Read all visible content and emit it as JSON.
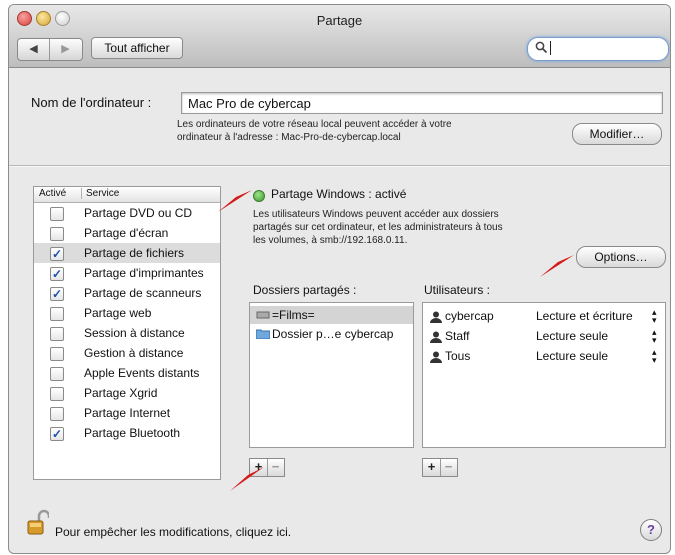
{
  "window": {
    "title": "Partage"
  },
  "toolbar": {
    "back_label": "◀",
    "forward_label": "▶",
    "show_all_label": "Tout afficher",
    "search_value": "",
    "search_icon": "magnifier-icon"
  },
  "computer": {
    "name_label": "Nom de l'ordinateur :",
    "name_value": "Mac Pro de cybercap",
    "note_line1": "Les ordinateurs de votre réseau local peuvent accéder à votre",
    "note_line2": "ordinateur à l'adresse : Mac-Pro-de-cybercap.local",
    "modify_label": "Modifier…"
  },
  "services": {
    "col_active": "Activé",
    "col_service": "Service",
    "items": [
      {
        "label": "Partage DVD ou CD",
        "checked": false,
        "selected": false
      },
      {
        "label": "Partage d'écran",
        "checked": false,
        "selected": false
      },
      {
        "label": "Partage de fichiers",
        "checked": true,
        "selected": true
      },
      {
        "label": "Partage d'imprimantes",
        "checked": true,
        "selected": false
      },
      {
        "label": "Partage de scanneurs",
        "checked": true,
        "selected": false
      },
      {
        "label": "Partage web",
        "checked": false,
        "selected": false
      },
      {
        "label": "Session à distance",
        "checked": false,
        "selected": false
      },
      {
        "label": "Gestion à distance",
        "checked": false,
        "selected": false
      },
      {
        "label": "Apple Events distants",
        "checked": false,
        "selected": false
      },
      {
        "label": "Partage Xgrid",
        "checked": false,
        "selected": false
      },
      {
        "label": "Partage Internet",
        "checked": false,
        "selected": false
      },
      {
        "label": "Partage Bluetooth",
        "checked": true,
        "selected": false
      }
    ]
  },
  "status": {
    "title": "Partage Windows : activé",
    "color": "#3a9a2b",
    "desc_line1": "Les utilisateurs Windows peuvent accéder aux dossiers",
    "desc_line2": "partagés sur cet ordinateur, et les administrateurs à tous",
    "desc_line3": "les volumes, à smb://192.168.0.11.",
    "options_label": "Options…"
  },
  "folders": {
    "heading": "Dossiers partagés :",
    "items": [
      {
        "label": "=Films=",
        "icon": "volume-icon",
        "selected": true
      },
      {
        "label": "Dossier p…e cybercap",
        "icon": "folder-icon",
        "selected": false
      }
    ]
  },
  "users": {
    "heading": "Utilisateurs :",
    "items": [
      {
        "name": "cybercap",
        "icon": "user-icon",
        "permission": "Lecture et écriture"
      },
      {
        "name": "Staff",
        "icon": "group-icon",
        "permission": "Lecture seule"
      },
      {
        "name": "Tous",
        "icon": "everyone-icon",
        "permission": "Lecture seule"
      }
    ]
  },
  "add_label": "+",
  "remove_label": "−",
  "lock": {
    "text": "Pour empêcher les modifications, cliquez ici."
  },
  "help_label": "?",
  "annotation_color": "#d61a1a"
}
